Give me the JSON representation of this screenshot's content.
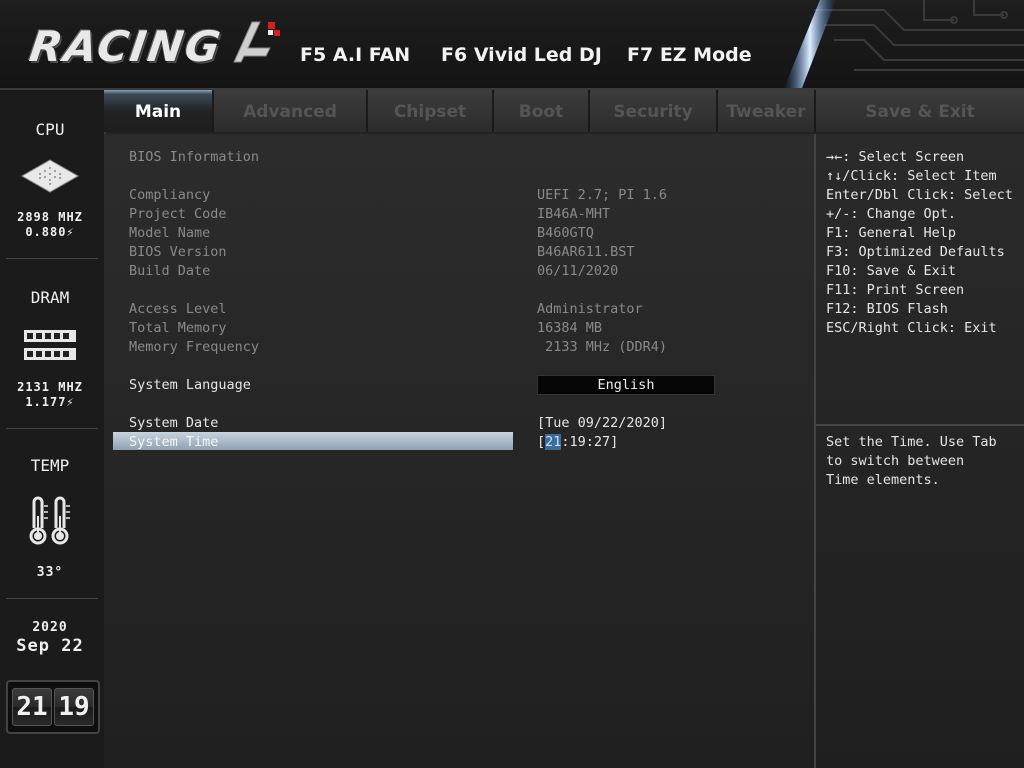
{
  "header": {
    "logo_text": "RACING",
    "hotkeys": [
      {
        "key_label": "F5 A.I FAN"
      },
      {
        "key_label": "F6 Vivid Led DJ"
      },
      {
        "key_label": "F7 EZ Mode"
      }
    ]
  },
  "sidebar": {
    "cpu": {
      "title": "CPU",
      "freq": "2898 MHZ",
      "volt": "0.880⚡"
    },
    "dram": {
      "title": "DRAM",
      "freq": "2131 MHZ",
      "volt": "1.177⚡"
    },
    "temp": {
      "title": "TEMP",
      "value": "33°"
    },
    "date": {
      "year": "2020",
      "month_day": "Sep 22"
    },
    "clock": {
      "hours": "21",
      "minutes": "19"
    }
  },
  "tabs": [
    {
      "label": "Main",
      "active": true
    },
    {
      "label": "Advanced"
    },
    {
      "label": "Chipset"
    },
    {
      "label": "Boot"
    },
    {
      "label": "Security"
    },
    {
      "label": "Tweaker"
    },
    {
      "label": "Save & Exit"
    }
  ],
  "main": {
    "section_title": "BIOS Information",
    "info_rows": [
      {
        "label": "Compliancy",
        "value": "UEFI 2.7; PI 1.6"
      },
      {
        "label": "Project Code",
        "value": "IB46A-MHT"
      },
      {
        "label": "Model Name",
        "value": "B460GTQ"
      },
      {
        "label": "BIOS Version",
        "value": "B46AR611.BST"
      },
      {
        "label": "Build Date",
        "value": "06/11/2020"
      },
      {
        "label": "Access Level",
        "value": "Administrator"
      },
      {
        "label": "Total Memory",
        "value": "16384 MB"
      },
      {
        "label": "Memory Frequency",
        "value": " 2133 MHz (DDR4)"
      }
    ],
    "system_language": {
      "label": "System Language",
      "value": "English"
    },
    "system_date": {
      "label": "System Date",
      "value": "[Tue 09/22/2020]"
    },
    "system_time": {
      "label": "System Time",
      "open_bracket": "[",
      "hour": "21",
      "rest": ":19:27]"
    }
  },
  "help": {
    "keys": [
      "→←: Select Screen",
      "↑↓/Click: Select Item",
      "Enter/Dbl Click: Select",
      "+/-: Change Opt.",
      "F1: General Help",
      "F3: Optimized Defaults",
      "F10: Save & Exit",
      "F11: Print Screen",
      "F12: BIOS Flash",
      "ESC/Right Click: Exit"
    ],
    "description": [
      "Set the Time. Use Tab",
      "to switch between",
      "Time elements."
    ]
  },
  "colors": {
    "active_tab_accent": "#8aa4b8",
    "highlight_bar": "#b8c6d2",
    "cursor": "#3b6c9e"
  }
}
